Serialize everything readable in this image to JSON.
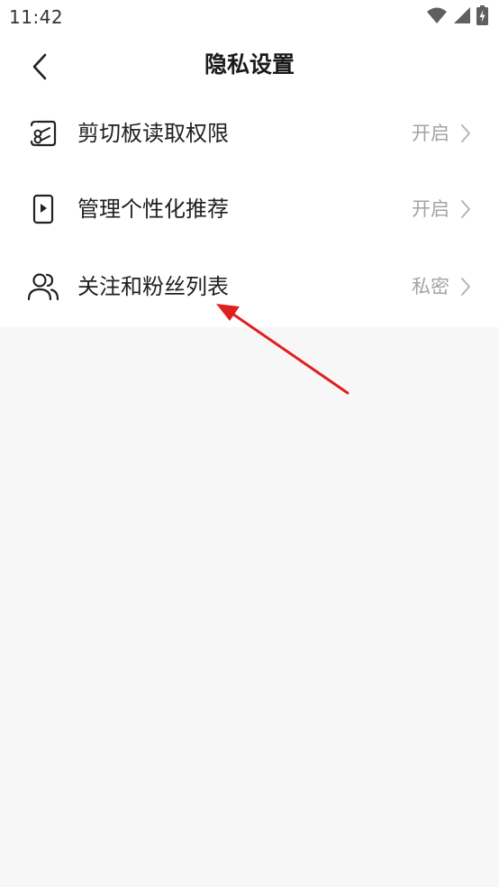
{
  "status_bar": {
    "time": "11:42",
    "icons": [
      "wifi-icon",
      "signal-icon",
      "battery-charging-icon"
    ]
  },
  "header": {
    "title": "隐私设置",
    "back_icon": "chevron-left-icon"
  },
  "settings": {
    "items": [
      {
        "icon": "clipboard-scissors-icon",
        "label": "剪切板读取权限",
        "value": "开启"
      },
      {
        "icon": "phone-play-icon",
        "label": "管理个性化推荐",
        "value": "开启"
      },
      {
        "icon": "users-icon",
        "label": "关注和粉丝列表",
        "value": "私密"
      }
    ]
  },
  "colors": {
    "background": "#f7f7f7",
    "card": "#ffffff",
    "text_primary": "#1f1f1f",
    "text_secondary": "#a3a3a3",
    "annotation_arrow": "#e02020"
  }
}
